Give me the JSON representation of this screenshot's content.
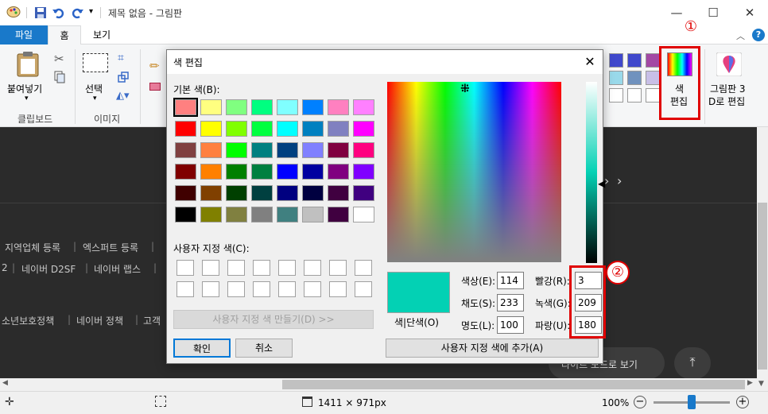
{
  "window": {
    "title": "제목 없음 - 그림판"
  },
  "tabs": [
    "파일",
    "홈",
    "보기"
  ],
  "ribbon": {
    "paste_label": "붙여넣기",
    "clipboard_group": "클립보드",
    "select_label": "선택",
    "image_group": "이미지",
    "edit_colors_label": [
      "색",
      "편집"
    ],
    "paint3d_label": [
      "그림판 3",
      "D로 편집"
    ]
  },
  "background_page": {
    "footer_links_1": [
      "지역업체 등록",
      "엑스퍼트 등록"
    ],
    "footer_links_2": [
      "2",
      "네이버 D2SF",
      "네이버 랩스"
    ],
    "footer_links_3": [
      "소년보호정책",
      "네이버 정책",
      "고객"
    ],
    "light_mode_button": "라이트 모드로 보기"
  },
  "dialog": {
    "title": "색 편집",
    "basic_colors_label": "기본 색(B):",
    "custom_colors_label": "사용자 지정 색(C):",
    "define_custom_button": "사용자 지정 색 만들기(D) >>",
    "ok_button": "확인",
    "cancel_button": "취소",
    "color_solid_label": "색|단색(O)",
    "add_custom_button": "사용자 지정 색에 추가(A)",
    "hue": {
      "label": "색상(E):",
      "value": "114"
    },
    "sat": {
      "label": "채도(S):",
      "value": "233"
    },
    "lum": {
      "label": "명도(L):",
      "value": "100"
    },
    "red": {
      "label": "빨강(R):",
      "value": "3"
    },
    "green": {
      "label": "녹색(G):",
      "value": "209"
    },
    "blue": {
      "label": "파랑(U):",
      "value": "180"
    },
    "current_color": "#03d1b4",
    "basic_colors": [
      "#ff8080",
      "#ffff80",
      "#80ff80",
      "#00ff80",
      "#80ffff",
      "#0080ff",
      "#ff80c0",
      "#ff80ff",
      "#ff0000",
      "#ffff00",
      "#80ff00",
      "#00ff40",
      "#00ffff",
      "#0080c0",
      "#8080c0",
      "#ff00ff",
      "#804040",
      "#ff8040",
      "#00ff00",
      "#008080",
      "#004080",
      "#8080ff",
      "#800040",
      "#ff0080",
      "#800000",
      "#ff8000",
      "#008000",
      "#008040",
      "#0000ff",
      "#0000a0",
      "#800080",
      "#8000ff",
      "#400000",
      "#804000",
      "#004000",
      "#004040",
      "#000080",
      "#000040",
      "#400040",
      "#400080",
      "#000000",
      "#808000",
      "#808040",
      "#808080",
      "#408080",
      "#c0c0c0",
      "#400040",
      "#ffffff"
    ]
  },
  "annotations": {
    "badge1": "①",
    "badge2": "②",
    "accent": "#e00000"
  },
  "status": {
    "dimensions": "1411 × 971px",
    "zoom": "100%",
    "zoom_level": 0.5
  }
}
